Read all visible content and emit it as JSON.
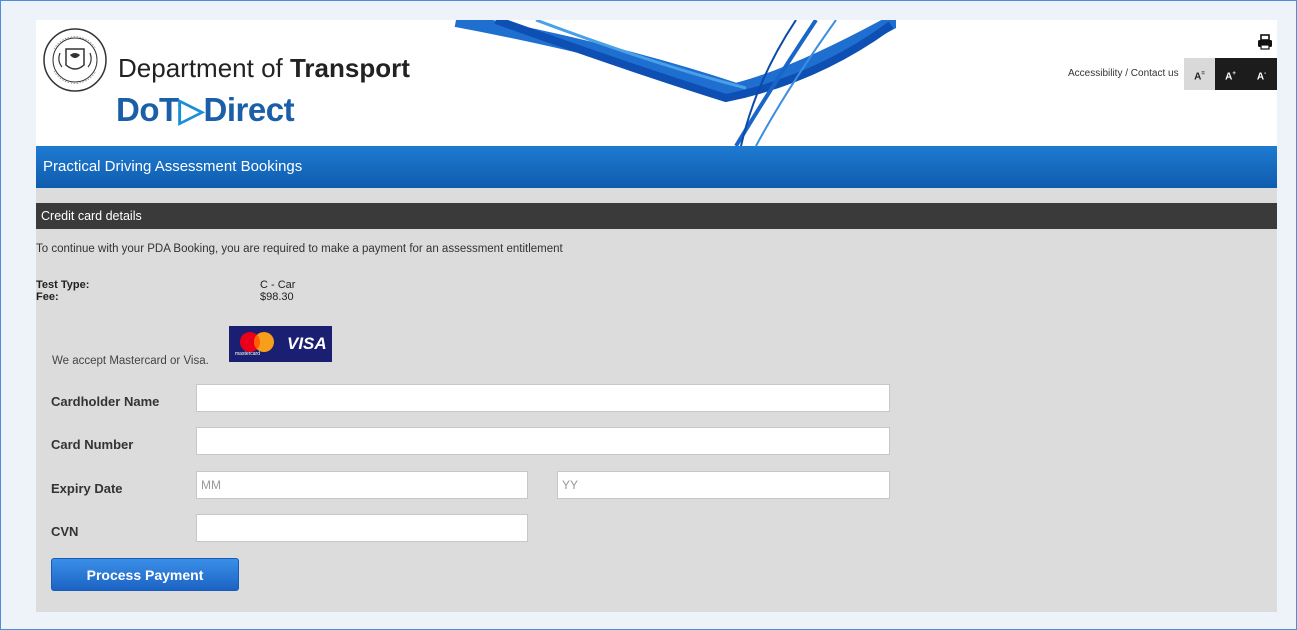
{
  "header": {
    "dept_prefix": "Department of ",
    "dept_bold": "Transport",
    "brand_part1": "DoT",
    "brand_part2": "Direct",
    "accessibility_link": "Accessibility / Contact us",
    "font_buttons": [
      "A",
      "A",
      "A"
    ]
  },
  "page_title": "Practical Driving Assessment Bookings",
  "section": {
    "title": "Credit card details",
    "intro": "To continue with your PDA Booking, you are required to make a payment for an assessment entitlement"
  },
  "summary": {
    "test_type_label": "Test Type:",
    "test_type_value": "C - Car",
    "fee_label": "Fee:",
    "fee_value": "$98.30"
  },
  "payment": {
    "accept_text": "We accept Mastercard or Visa.",
    "mastercard_text": "mastercard",
    "visa_text": "VISA"
  },
  "form": {
    "cardholder_label": "Cardholder Name",
    "cardholder_value": "",
    "card_number_label": "Card Number",
    "card_number_value": "",
    "expiry_label": "Expiry Date",
    "expiry_month_placeholder": "MM",
    "expiry_year_placeholder": "YY",
    "cvn_label": "CVN",
    "cvn_value": "",
    "submit_label": "Process Payment"
  },
  "colors": {
    "brand_blue": "#1a5fa8",
    "title_bar": "#1a6fc4",
    "section_bar": "#3a3a3a",
    "button": "#2a7ad8"
  }
}
